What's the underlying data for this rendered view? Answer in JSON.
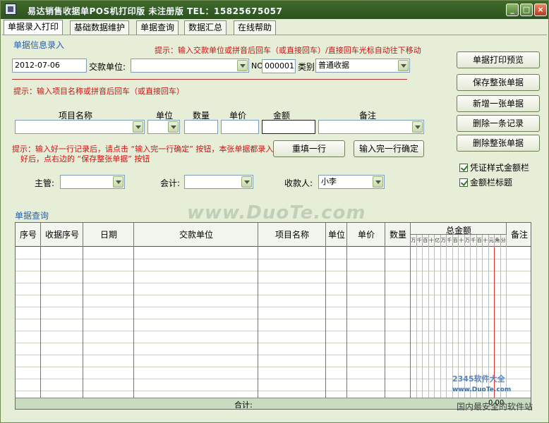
{
  "window": {
    "title": "易达销售收据单POS机打印版  未注册版    TEL：15825675057"
  },
  "tabs": [
    "单据录入打印",
    "基础数据维护",
    "单据查询",
    "数据汇总",
    "在线帮助"
  ],
  "entry": {
    "group_title": "单据信息录入",
    "hint_top": "提示：输入交款单位或拼音后回车（或直接回车）/直接回车光标自动往下移动",
    "date_value": "2012-07-06",
    "payer_label": "交款单位:",
    "no_label": "NO.",
    "no_value": "000001",
    "type_label": "类别",
    "type_value": "普通收据",
    "hint_item": "提示：输入项目名称或拼音后回车（或直接回车）",
    "col_item": "项目名称",
    "col_unit": "单位",
    "col_qty": "数量",
    "col_price": "单价",
    "col_amount": "金额",
    "col_note": "备注",
    "hint_row_1": "提示：输入好一行记录后，请点击 “输入完一行确定” 按钮，本张单据都录入",
    "hint_row_2": "好后，点右边的 “保存整张单据” 按钮",
    "refill_btn": "重填一行",
    "confirm_btn": "输入完一行确定",
    "manager_label": "主管:",
    "accountant_label": "会计:",
    "payee_label": "收款人:",
    "payee_value": "小李"
  },
  "side_buttons": [
    "单据打印预览",
    "保存整张单据",
    "新增一张单据",
    "删除一条记录",
    "删除整张单据"
  ],
  "checks": [
    "凭证样式金额栏",
    "金额栏标题"
  ],
  "query": {
    "group_title": "单据查询",
    "columns": [
      "序号",
      "收据序号",
      "日期",
      "交款单位",
      "项目名称",
      "单位",
      "单价",
      "数量",
      "总金额",
      "备注"
    ],
    "amount_digits": [
      "万",
      "千",
      "百",
      "十",
      "亿",
      "万",
      "千",
      "百",
      "十",
      "万",
      "千",
      "百",
      "十",
      "元",
      "角",
      "分"
    ],
    "total_label": "合计:",
    "total_value": "0.00"
  },
  "watermark": "www.DuoTe.com",
  "corner_logo": "2345软件大全",
  "corner_url": "www.DuoTe.com",
  "corner_text": "国内最安全的软件站"
}
